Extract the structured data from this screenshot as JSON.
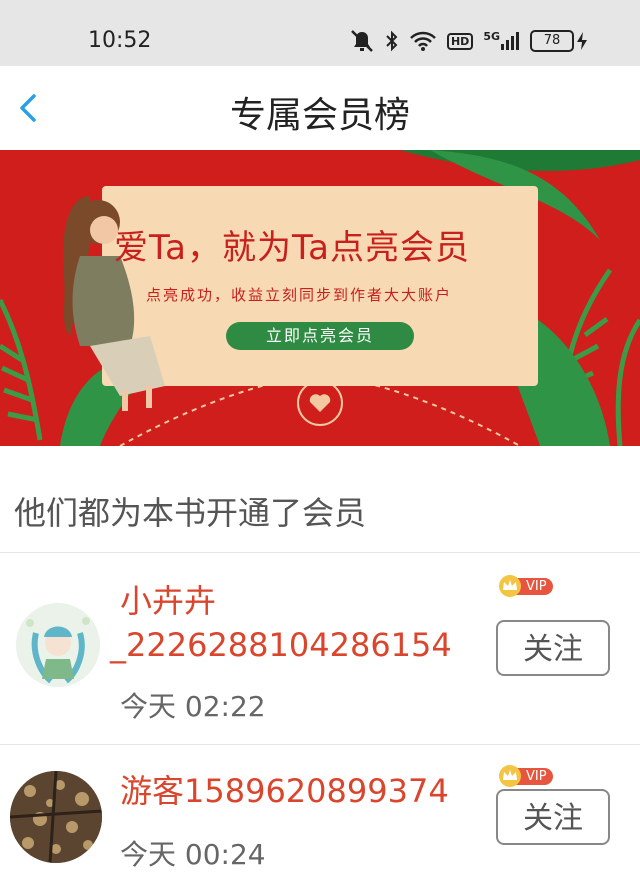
{
  "status_bar": {
    "time": "10:52",
    "signal_label": "5G",
    "hd_label": "HD",
    "battery": "78"
  },
  "nav": {
    "title": "专属会员榜"
  },
  "banner": {
    "headline": "爱Ta，就为Ta点亮会员",
    "subline": "点亮成功，收益立刻同步到作者大大账户",
    "cta": "立即点亮会员"
  },
  "section": {
    "title": "他们都为本书开通了会员"
  },
  "members": [
    {
      "name_line1": "小卉卉",
      "name_line2": "_2226288104286154",
      "time": "今天 02:22",
      "badge": "VIP",
      "follow_label": "关注"
    },
    {
      "name_line1": "游客1589620899374",
      "time": "今天 00:24",
      "badge": "VIP",
      "follow_label": "关注"
    }
  ],
  "colors": {
    "accent_red": "#d9452d",
    "banner_red": "#cf1e1c",
    "cta_green": "#2f8b43",
    "back_blue": "#2b9fe6"
  }
}
